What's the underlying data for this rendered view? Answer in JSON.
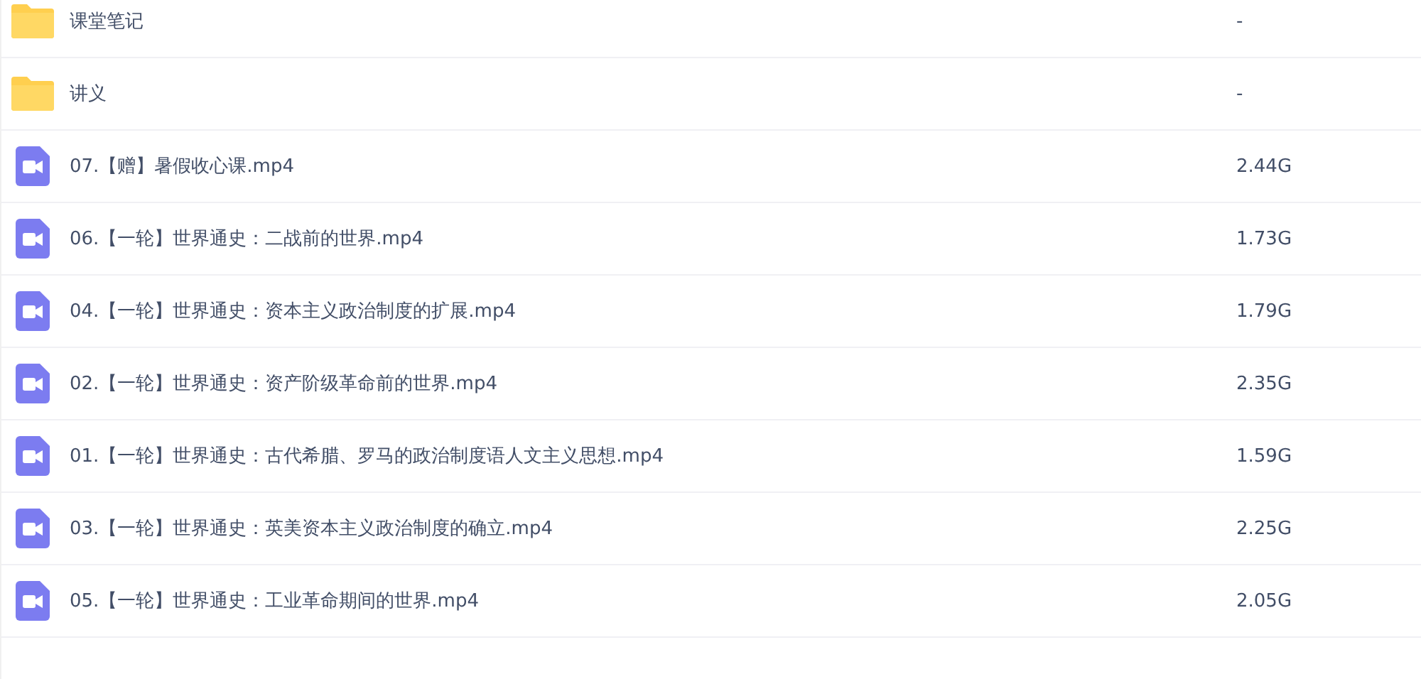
{
  "files": [
    {
      "kind": "folder",
      "name": "课堂笔记",
      "size": "-"
    },
    {
      "kind": "folder",
      "name": "讲义",
      "size": "-"
    },
    {
      "kind": "video",
      "name": "07.【赠】暑假收心课.mp4",
      "size": "2.44G"
    },
    {
      "kind": "video",
      "name": "06.【一轮】世界通史：二战前的世界.mp4",
      "size": "1.73G"
    },
    {
      "kind": "video",
      "name": "04.【一轮】世界通史：资本主义政治制度的扩展.mp4",
      "size": "1.79G"
    },
    {
      "kind": "video",
      "name": "02.【一轮】世界通史：资产阶级革命前的世界.mp4",
      "size": "2.35G"
    },
    {
      "kind": "video",
      "name": "01.【一轮】世界通史：古代希腊、罗马的政治制度语人文主义思想.mp4",
      "size": "1.59G"
    },
    {
      "kind": "video",
      "name": "03.【一轮】世界通史：英美资本主义政治制度的确立.mp4",
      "size": "2.25G"
    },
    {
      "kind": "video",
      "name": "05.【一轮】世界通史：工业革命期间的世界.mp4",
      "size": "2.05G"
    }
  ]
}
